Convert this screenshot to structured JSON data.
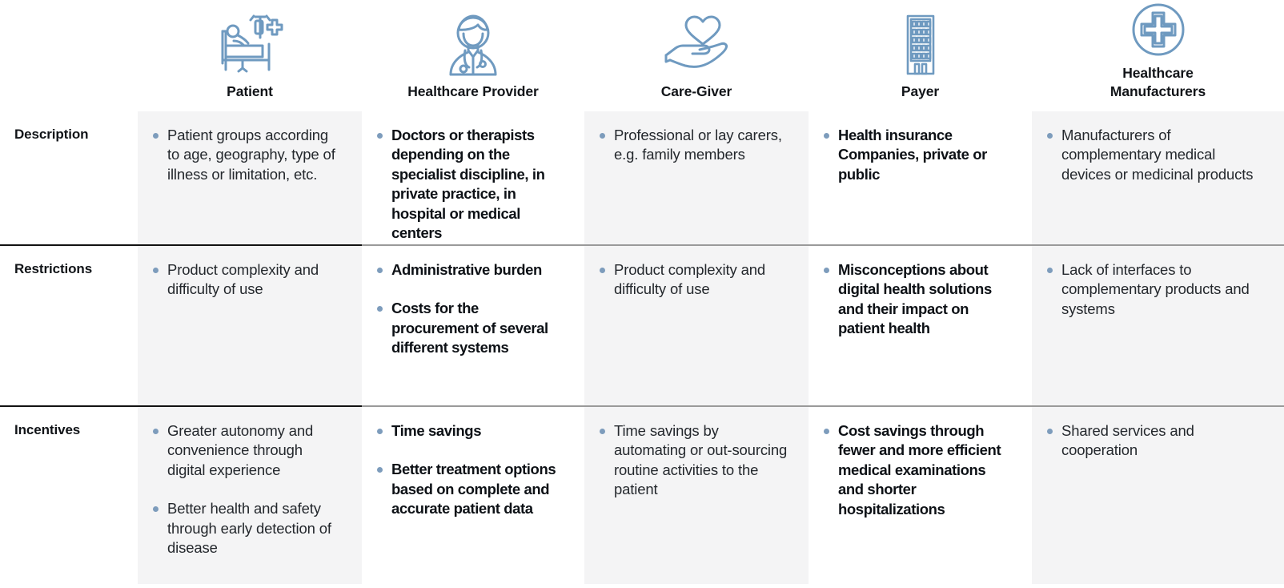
{
  "stakeholders": [
    {
      "key": "patient",
      "label": "Patient",
      "icon": "patient-in-bed-icon",
      "emphasis": false
    },
    {
      "key": "provider",
      "label": "Healthcare Provider",
      "icon": "doctor-icon",
      "emphasis": true
    },
    {
      "key": "caregiver",
      "label": "Care-Giver",
      "icon": "heart-in-hand-icon",
      "emphasis": false
    },
    {
      "key": "payer",
      "label": "Payer",
      "icon": "office-building-icon",
      "emphasis": true
    },
    {
      "key": "manufacturer",
      "label": "Healthcare\nManufacturers",
      "icon": "medical-cross-circle-icon",
      "emphasis": false
    }
  ],
  "header": {
    "labels": {
      "patient": "Patient",
      "provider": "Healthcare Provider",
      "caregiver": "Care-Giver",
      "payer": "Payer",
      "manufacturer_line1": "Healthcare",
      "manufacturer_line2": "Manufacturers"
    }
  },
  "rows": [
    {
      "key": "description",
      "label": "Description",
      "cells": {
        "patient": [
          "Patient groups according to age, geography, type of illness or limitation, etc."
        ],
        "provider": [
          "Doctors or therapists depending on the specialist discipline, in private practice, in hospital or medical centers"
        ],
        "caregiver": [
          "Professional or lay carers, e.g. family members"
        ],
        "payer": [
          "Health insurance Companies, private or public"
        ],
        "manufacturer": [
          "Manufacturers of complementary medical devices or medicinal products"
        ]
      }
    },
    {
      "key": "restrictions",
      "label": "Restrictions",
      "cells": {
        "patient": [
          "Product complexity and difficulty of use"
        ],
        "provider": [
          "Administrative burden",
          "Costs for the procurement of several different systems"
        ],
        "caregiver": [
          "Product complexity and difficulty of use"
        ],
        "payer": [
          "Misconceptions about digital health solutions and their impact on patient health"
        ],
        "manufacturer": [
          "Lack of interfaces to complementary products and systems"
        ]
      }
    },
    {
      "key": "incentives",
      "label": "Incentives",
      "cells": {
        "patient": [
          "Greater autonomy and convenience through digital experience",
          "Better health and safety through early detection of disease"
        ],
        "provider": [
          "Time savings",
          "Better treatment options based on complete and accurate patient data"
        ],
        "caregiver": [
          "Time savings by automating or out-sourcing routine activities to the patient"
        ],
        "payer": [
          "Cost savings through fewer and more efficient medical examinations and shorter hospitalizations"
        ],
        "manufacturer": [
          "Shared services and cooperation"
        ]
      }
    }
  ],
  "colors": {
    "accent_rule": "#89a5c3",
    "bullet": "#7d9cbc",
    "shaded_cell": "#f4f4f5",
    "plain_cell": "#ffffff",
    "icon_stroke": "#6f9ac0",
    "text": "#24282d",
    "separator_dark": "#121212",
    "separator_light": "#9a9a9a"
  }
}
